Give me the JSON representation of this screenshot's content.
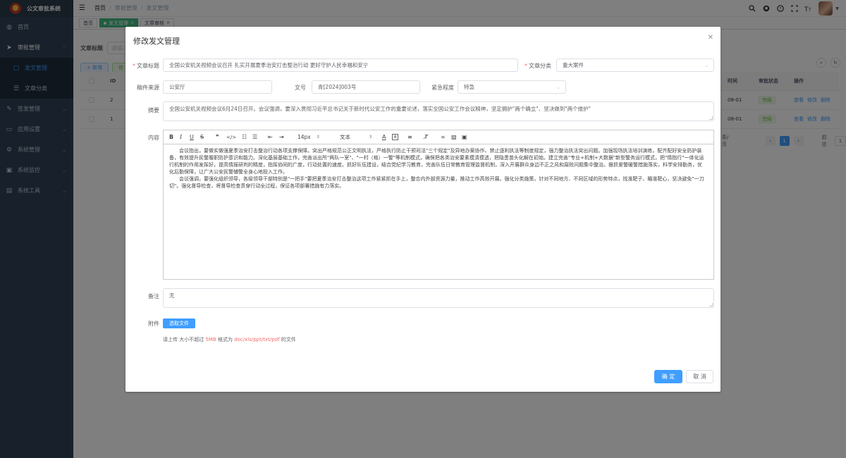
{
  "app": {
    "title": "公文审批系统"
  },
  "sidebar": {
    "items": [
      {
        "label": "首页",
        "icon": "dashboard-icon"
      },
      {
        "label": "审批管理",
        "icon": "send-icon"
      },
      {
        "label": "签发管理",
        "icon": "edit-icon"
      },
      {
        "label": "应用设置",
        "icon": "app-icon"
      },
      {
        "label": "系统管理",
        "icon": "gear-icon"
      },
      {
        "label": "系统监控",
        "icon": "monitor-icon"
      },
      {
        "label": "系统工具",
        "icon": "tool-icon"
      }
    ],
    "subitems": [
      {
        "label": "发文管理",
        "icon": "document-icon",
        "active": true
      },
      {
        "label": "文章分类",
        "icon": "list-icon"
      }
    ]
  },
  "header": {
    "breadcrumb": [
      "首页",
      "审批管理",
      "发文管理"
    ],
    "icons": [
      "search-icon",
      "github-icon",
      "question-icon",
      "fullscreen-icon",
      "font-size-icon"
    ]
  },
  "tags": [
    {
      "label": "首页",
      "active": false
    },
    {
      "label": "发文管理",
      "active": true
    },
    {
      "label": "文章审核",
      "active": false
    }
  ],
  "background": {
    "search_label": "文章标题",
    "search_placeholder": "请输入",
    "add_label": "+ 新增",
    "edit_label": "修",
    "columns": {
      "id": "ID",
      "time": "时间",
      "status": "审批状态",
      "ops": "操作"
    },
    "rows": [
      {
        "id": "2",
        "time": "08-01",
        "status": "完结"
      },
      {
        "id": "1",
        "time": "08-01",
        "status": "完结"
      }
    ],
    "ops": [
      "查看",
      "修改",
      "删除"
    ],
    "pager": {
      "size": "条/页",
      "current": "1",
      "goto": "前往",
      "page_input": "1"
    }
  },
  "dialog": {
    "title": "修改发文管理",
    "fields": {
      "title_label": "文章标题",
      "title_value": "全国公安机关视频会议召开 扎实开展夏季治安打击整治行动 更好守护人民幸福和安宁",
      "category_label": "文章分类",
      "category_value": "重大案件",
      "source_label": "稿件来源",
      "source_value": "公安厅",
      "docno_label": "文号",
      "docno_value": "青[2024]003号",
      "urgency_label": "紧急程度",
      "urgency_value": "特急",
      "summary_label": "摘要",
      "summary_value": "全国公安机关视频会议6月24日召开。会议强调，要深入贯彻习近平总书记关于新时代公安工作的重要论述，落实全国公安工作会议精神，坚定拥护\"两个确立\"、坚决做到\"两个维护\"",
      "content_label": "内容",
      "remark_label": "备注",
      "remark_value": "无",
      "attachment_label": "附件"
    },
    "editor": {
      "font_size": "14px",
      "block_type": "文本",
      "paragraphs": [
        "会议指出，要做实做强夏季治安打击整治行动各项支撑保障。突出严格规范公正文明执法，严格执行防止干预司法\"三个规定\"及异地办案协作、禁止逐利执法等制度规定，强力整治执法突出问题。加强现场执法培训演练，配齐配好安全防护装备，有效提升民警履职防护意识和能力。深化基层基础工作，完善派出所\"两队一室\"、\"一村（格）一警\"等机制模式，确保把各类治安要素摸清摸透，把隐患苗头化解在初始。建立完善\"专业+机制+大数据\"新型警务运行模式，把\"情指行\"一体化运行机制的作用发挥好，提高情报研判的精度，指挥协同的广度，行动处置的速度。抓好队伍建设，结合党纪学习教育，完善队伍日常教育管理监督机制，深入开展群众身边不正之风和腐败问题集中整治。狠抓爱警暖警措施落实，科学安排勤务，优化后勤保障，让广大公安民警辅警全身心地投入工作。",
        "会议强调，要强化组织领导，各级领导干部特别是\"一把手\"要把夏季治安打击整治这项工作紧紧抓在手上，整合内外部资源力量，推动工作高效开展。强化分类施策，针对不同地方、不同区域的形势特点，找准靶子、瞄准靶心，坚决避免\"一刀切\"。强化督导检查，将督导检查贯穿行动全过程，保证各项部署措施有力落实。"
      ]
    },
    "upload": {
      "button_label": "选取文件",
      "tip_prefix": "请上传 大小不超过 ",
      "tip_size": "5MB",
      "tip_mid": " 格式为 ",
      "tip_formats": "doc/xls/ppt/txt/pdf",
      "tip_suffix": " 的文件"
    },
    "confirm_label": "确 定",
    "cancel_label": "取 消"
  },
  "colors": {
    "primary": "#409eff",
    "sidebar_bg": "#304156",
    "tag_active": "#42b983",
    "danger": "#f56c6c",
    "success": "#67c23a"
  }
}
